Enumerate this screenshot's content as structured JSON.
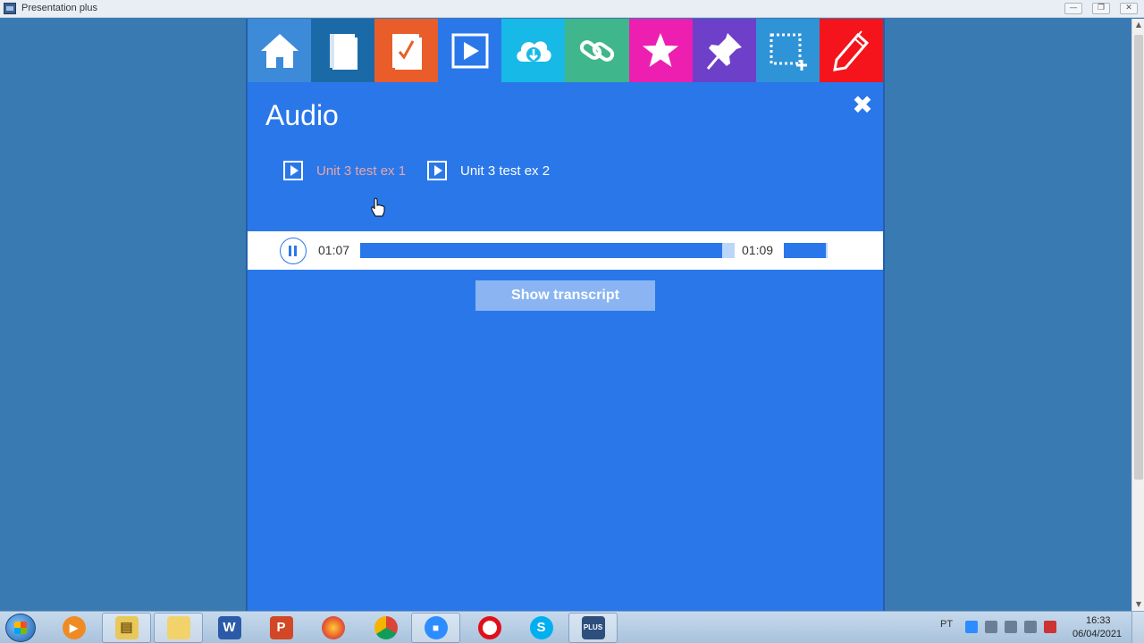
{
  "window": {
    "title": "Presentation plus",
    "min_label": "—",
    "max_label": "❐",
    "close_label": "✕"
  },
  "toolbar": {
    "items": [
      {
        "name": "home",
        "color": "#3c8ad8"
      },
      {
        "name": "book",
        "color": "#1b6aa8"
      },
      {
        "name": "test",
        "color": "#e95d2a"
      },
      {
        "name": "play",
        "color": "#2a77ea"
      },
      {
        "name": "download",
        "color": "#17b9e6"
      },
      {
        "name": "link",
        "color": "#3fb68c"
      },
      {
        "name": "star",
        "color": "#ec1fb0"
      },
      {
        "name": "pin",
        "color": "#6e3fc8"
      },
      {
        "name": "select",
        "color": "#2f93d8"
      },
      {
        "name": "pencil",
        "color": "#f5141b"
      }
    ]
  },
  "audio": {
    "title": "Audio",
    "close_label": "✖",
    "tracks": [
      {
        "label": "Unit 3 test ex 1",
        "state": "playing"
      },
      {
        "label": "Unit 3 test ex 2",
        "state": "idle"
      }
    ]
  },
  "player": {
    "current_time": "01:07",
    "total_time": "01:09",
    "progress": 0.967,
    "volume": 0.95
  },
  "transcript_button": "Show transcript",
  "taskbar": {
    "apps": [
      "media-player",
      "file-explorer",
      "folder",
      "word",
      "powerpoint",
      "firefox",
      "chrome",
      "zoom",
      "opera",
      "skype",
      "presentation-plus"
    ],
    "language": "PT",
    "time": "16:33",
    "date": "06/04/2021"
  }
}
